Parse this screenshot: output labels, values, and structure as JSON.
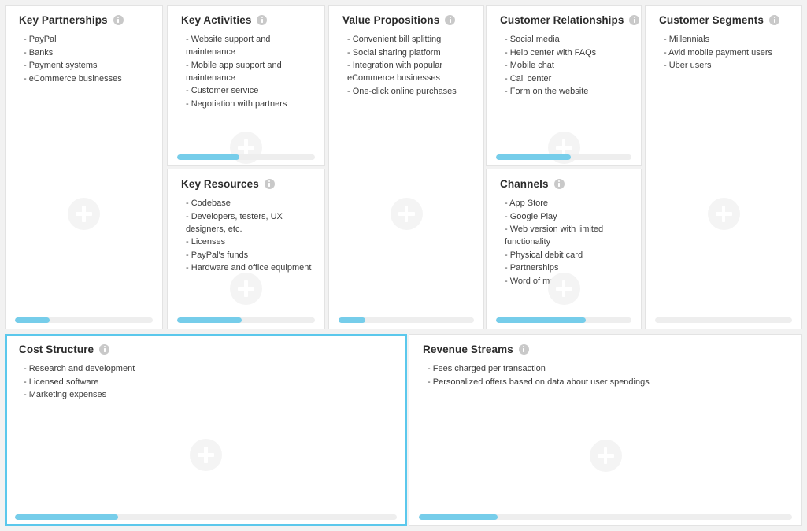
{
  "theme": {
    "accent": "#5bc8ec",
    "progress_fill": "#76cdea",
    "progress_track": "#eeeeee",
    "cell_border": "#e3e3e3",
    "page_background": "#f2f2f2",
    "title_color": "#2b2b2b",
    "text_color": "#3c3c3c",
    "info_icon_color": "#c9c9c9",
    "add_button_color": "#f4f4f4"
  },
  "icons": {
    "info": "info-icon",
    "add": "plus-icon"
  },
  "blocks": {
    "key_partnerships": {
      "title": "Key Partnerships",
      "progress": 25,
      "items": [
        "PayPal",
        "Banks",
        "Payment systems",
        "eCommerce businesses"
      ]
    },
    "key_activities": {
      "title": "Key Activities",
      "progress": 45,
      "items": [
        "Website support and maintenance",
        "Mobile app support and maintenance",
        "Customer service",
        "Negotiation with partners"
      ]
    },
    "key_resources": {
      "title": "Key Resources",
      "progress": 47,
      "items": [
        "Codebase",
        "Developers, testers, UX designers, etc.",
        "Licenses",
        "PayPal's funds",
        "Hardware and office equipment"
      ]
    },
    "value_propositions": {
      "title": "Value Propositions",
      "progress": 20,
      "items": [
        "Convenient bill splitting",
        "Social sharing platform",
        "Integration with popular eCommerce businesses",
        "One-click online purchases"
      ]
    },
    "customer_relationships": {
      "title": "Customer Relationships",
      "progress": 55,
      "items": [
        "Social media",
        "Help center with FAQs",
        "Mobile chat",
        "Call center",
        "Form on the website"
      ]
    },
    "channels": {
      "title": "Channels",
      "progress": 66,
      "items": [
        "App Store",
        "Google Play",
        "Web version with limited functionality",
        "Physical debit card",
        "Partnerships",
        "Word of mouth"
      ]
    },
    "customer_segments": {
      "title": "Customer Segments",
      "progress": 0,
      "items": [
        "Millennials",
        "Avid mobile payment users",
        "Uber users"
      ]
    },
    "cost_structure": {
      "title": "Cost Structure",
      "progress": 27,
      "selected": true,
      "items": [
        "Research and development",
        "Licensed software",
        "Marketing expenses"
      ]
    },
    "revenue_streams": {
      "title": "Revenue Streams",
      "progress": 21,
      "items": [
        "Fees charged per transaction",
        "Personalized offers based on data about user spendings"
      ]
    }
  }
}
